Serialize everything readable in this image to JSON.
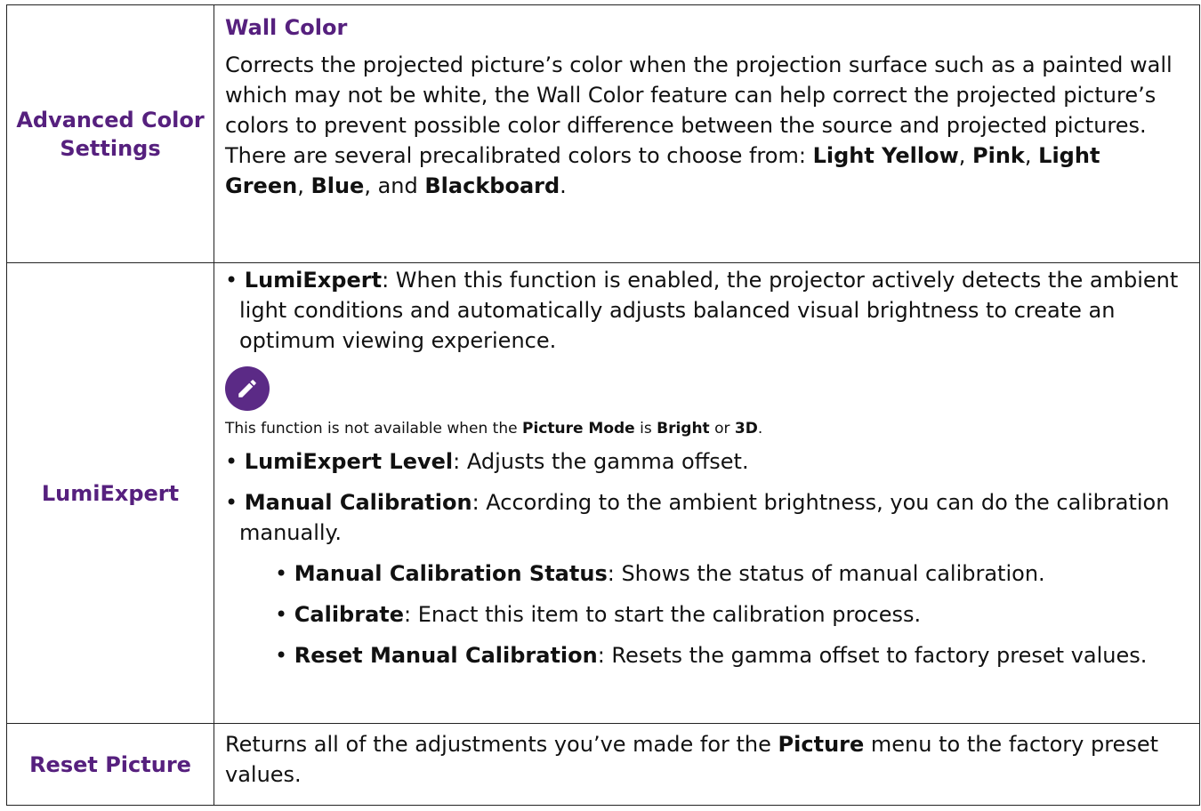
{
  "rows": [
    {
      "label": "Advanced Color Settings",
      "heading": "Wall Color",
      "para_intro": "Corrects the projected picture’s color when the projection surface such as a painted wall which may not be white, the Wall Color feature can help correct the projected picture’s colors to prevent possible color difference between the source and projected pictures. There are several precalibrated colors to choose from:",
      "colors": [
        "Light Yellow",
        "Pink",
        "Light Green",
        "Blue",
        "Blackboard"
      ],
      "sep_comma": ", ",
      "sep_and": ", and ",
      "end_period": "."
    },
    {
      "label": "LumiExpert",
      "bullet": "• ",
      "item1_term": "LumiExpert",
      "item1_text": ": When this function is enabled, the projector actively detects the ambient light conditions and automatically adjusts balanced visual brightness to create an optimum viewing experience.",
      "note_icon": "pencil-icon",
      "note_a": "This function is not available when the ",
      "note_b1": "Picture Mode",
      "note_c": " is ",
      "note_b2": "Bright",
      "note_d": " or ",
      "note_b3": "3D",
      "note_e": ".",
      "item2_term": "LumiExpert Level",
      "item2_text": ": Adjusts the gamma offset.",
      "item3_term": "Manual Calibration",
      "item3_text": ": According to the ambient brightness, you can do the calibration manually.",
      "sub1_term": "Manual Calibration Status",
      "sub1_text": ": Shows the status of manual calibration.",
      "sub2_term": "Calibrate",
      "sub2_text": ": Enact this item to start the calibration process.",
      "sub3_term": "Reset Manual Calibration",
      "sub3_text": ": Resets the gamma offset to factory preset values."
    },
    {
      "label": "Reset Picture",
      "text_a": "Returns all of the adjustments you’ve made for the ",
      "text_b": "Picture",
      "text_c": " menu to the factory preset values."
    }
  ],
  "colors": {
    "heading": "#56207e",
    "icon_bg": "#5b2a86",
    "border": "#222222"
  }
}
